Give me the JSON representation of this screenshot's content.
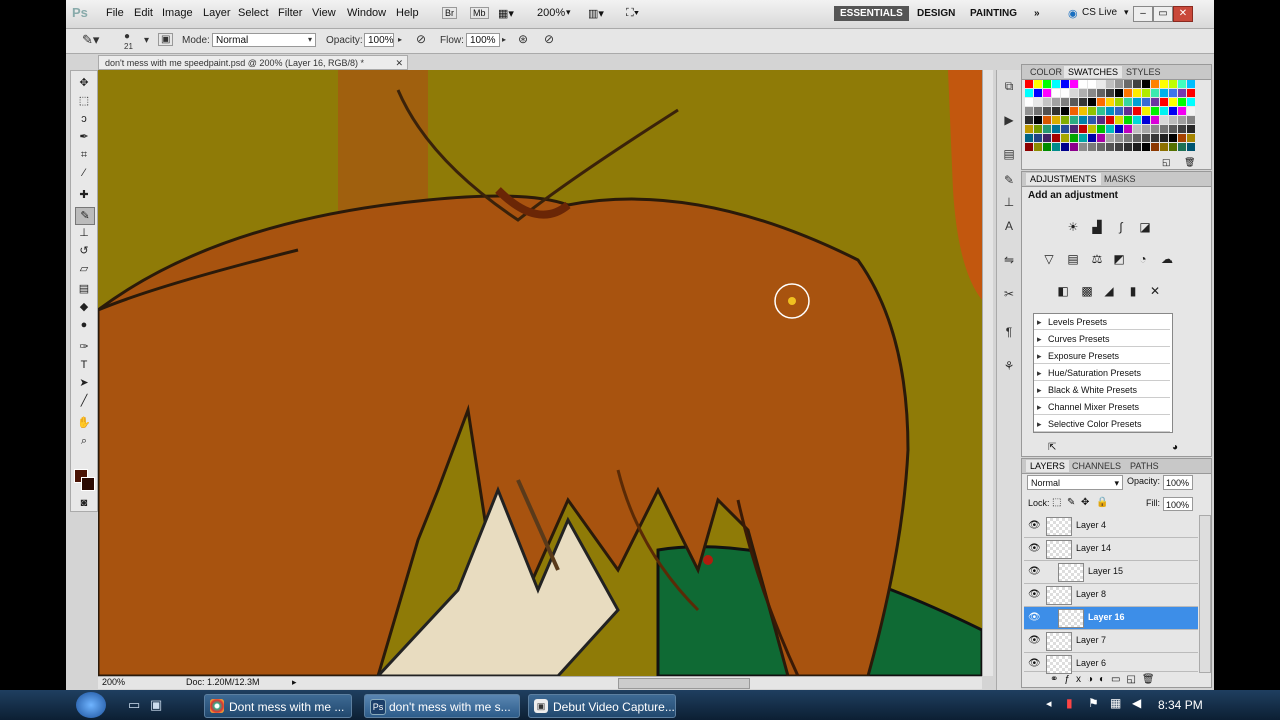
{
  "app": {
    "logo": "Ps",
    "menus": [
      "File",
      "Edit",
      "Image",
      "Layer",
      "Select",
      "Filter",
      "View",
      "Window",
      "Help"
    ],
    "zoom": "200%",
    "workspaces": [
      "ESSENTIALS",
      "DESIGN",
      "PAINTING"
    ],
    "cs_live": "CS Live"
  },
  "options": {
    "brush_size": "21",
    "mode_label": "Mode:",
    "mode_value": "Normal",
    "opacity_label": "Opacity:",
    "opacity_value": "100%",
    "flow_label": "Flow:",
    "flow_value": "100%"
  },
  "document": {
    "tab_title": "don't mess with me speedpaint.psd @ 200% (Layer 16, RGB/8) *",
    "status_zoom": "200%",
    "status_doc": "Doc: 1.20M/12.3M"
  },
  "panels": {
    "swatch_tabs": [
      "COLOR",
      "SWATCHES",
      "STYLES"
    ],
    "adjust_tabs": [
      "ADJUSTMENTS",
      "MASKS"
    ],
    "adjust_heading": "Add an adjustment",
    "presets": [
      "Levels Presets",
      "Curves Presets",
      "Exposure Presets",
      "Hue/Saturation Presets",
      "Black & White Presets",
      "Channel Mixer Presets",
      "Selective Color Presets"
    ],
    "layer_tabs": [
      "LAYERS",
      "CHANNELS",
      "PATHS"
    ],
    "blend_mode": "Normal",
    "opacity_label": "Opacity:",
    "opacity_value": "100%",
    "lock_label": "Lock:",
    "fill_label": "Fill:",
    "fill_value": "100%",
    "layers": [
      "Layer 4",
      "Layer 14",
      "Layer 15",
      "Layer 8",
      "Layer 16",
      "Layer 7",
      "Layer 6"
    ],
    "selected_layer": "Layer 16"
  },
  "taskbar": {
    "items": [
      "Dont mess with me ...",
      "don't mess with me s...",
      "Debut Video Capture..."
    ],
    "clock": "8:34 PM"
  },
  "colors": {
    "canvas_bg": "#8f7b07",
    "hair": "#a8530f",
    "selection": "#3d8ee8",
    "foreground": "#4a1405"
  }
}
